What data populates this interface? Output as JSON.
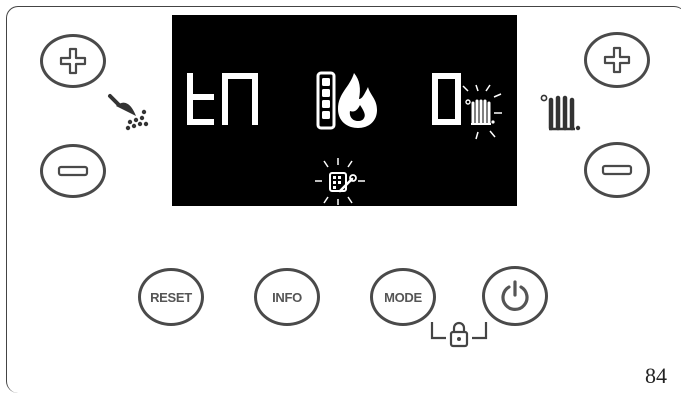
{
  "panel": {
    "page_number": "84",
    "buttons": {
      "reset_label": "RESET",
      "info_label": "INFO",
      "mode_label": "MODE"
    },
    "icons": {
      "dhw_plus": "plus-icon",
      "dhw_minus": "minus-icon",
      "heating_plus": "plus-icon",
      "heating_minus": "minus-icon",
      "dhw_indicator": "shower-tap-icon",
      "heating_indicator": "radiator-icon",
      "power": "power-icon",
      "lock": "padlock-icon"
    }
  },
  "display": {
    "left_segment_text": "tn",
    "right_segment_text": "0",
    "icons": [
      "boiler-level-icon",
      "flame-icon",
      "radiator-blinking-icon",
      "service-wrench-blinking-icon"
    ],
    "background_color": "#000000",
    "segment_color": "#ffffff"
  }
}
